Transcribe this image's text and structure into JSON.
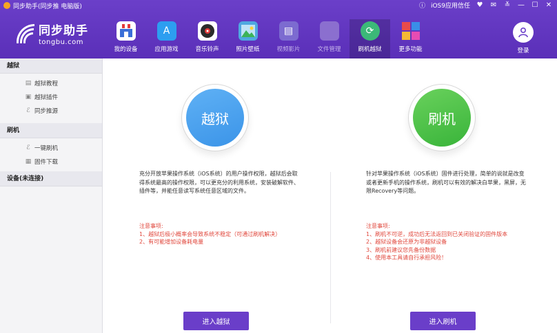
{
  "titlebar": {
    "app_title": "同步助手(同步推 电脑版)",
    "ios9_trust": "iOS9应用信任"
  },
  "logo": {
    "cn": "同步助手",
    "en": "tongbu.com"
  },
  "nav": [
    {
      "label": "我的设备",
      "icon": "store-icon",
      "color": "#ffffff"
    },
    {
      "label": "应用游戏",
      "icon": "appstore-icon",
      "color": "#2d9ef0"
    },
    {
      "label": "音乐铃声",
      "icon": "music-disc-icon",
      "color": "#2b2b2b"
    },
    {
      "label": "照片壁纸",
      "icon": "photo-icon",
      "color": "#4fa8e0"
    },
    {
      "label": "视频影片",
      "icon": "video-icon",
      "color": "#7c6bd0"
    },
    {
      "label": "文件管理",
      "icon": "folder-icon",
      "color": "#8b6fcf"
    },
    {
      "label": "刷机越狱",
      "icon": "flash-icon",
      "color": "#3cb878"
    },
    {
      "label": "更多功能",
      "icon": "more-grid-icon",
      "color": "#f0a23a"
    }
  ],
  "login": {
    "label": "登录"
  },
  "sidebar": {
    "sections": [
      {
        "title": "越狱",
        "items": [
          {
            "label": "越狱教程",
            "icon": "book-icon"
          },
          {
            "label": "越狱插件",
            "icon": "gift-icon"
          },
          {
            "label": "同步推源",
            "icon": "tongbu-icon"
          }
        ]
      },
      {
        "title": "刷机",
        "items": [
          {
            "label": "一键刷机",
            "icon": "tongbu-icon"
          },
          {
            "label": "固件下载",
            "icon": "box-icon"
          }
        ]
      },
      {
        "title": "设备(未连接)",
        "items": []
      }
    ]
  },
  "jailbreak": {
    "circle_label": "越狱",
    "desc": "充分开放苹果操作系统（iOS系统）的用户操作权限，越狱后会取得系统最高的操作权限，可以更充分的利用系统，安装破解软件、插件等，并能任意读写系统任意区域的文件。",
    "notes_title": "注意事项:",
    "notes": [
      "1、越狱后极小概率会导致系统不稳定（可通过刷机解决）",
      "2、有可能增加设备耗电量"
    ],
    "button": "进入越狱"
  },
  "flash": {
    "circle_label": "刷机",
    "desc": "针对苹果操作系统（iOS系统）固件进行处理，简单的说就是改变或者更新手机的操作系统，刷机可以有效的解决白苹果，黑屏，无限Recovery等问题。",
    "notes_title": "注意事项:",
    "notes": [
      "1、刷机不可逆，成功后无法返回到已关闭验证的固件版本",
      "2、越狱设备会还原为非越狱设备",
      "3、刷机前建议您先备份数据",
      "4、使用本工具请自行承担风险！"
    ],
    "button": "进入刷机"
  }
}
